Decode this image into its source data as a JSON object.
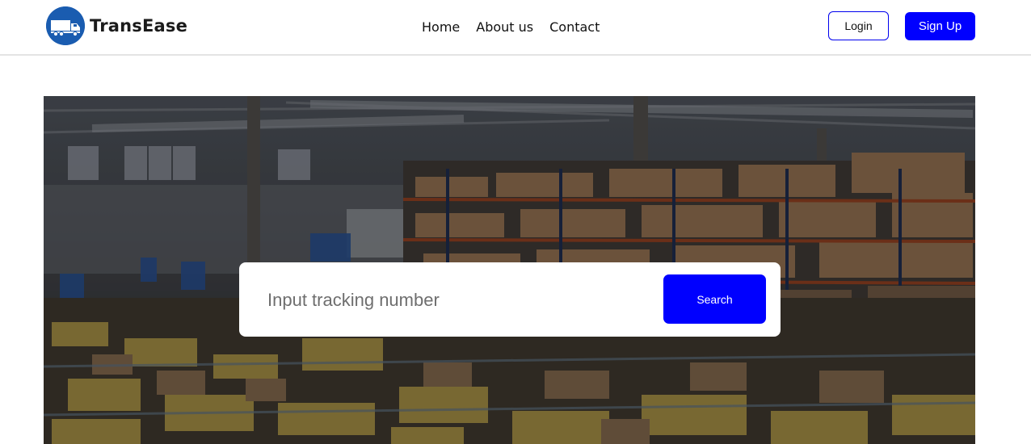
{
  "brand": {
    "name": "TransEase",
    "logo_icon": "truck-icon",
    "logo_color": "#1a5cb0"
  },
  "nav": {
    "links": [
      "Home",
      "About us",
      "Contact"
    ]
  },
  "auth": {
    "login_label": "Login",
    "signup_label": "Sign Up",
    "accent": "#0000ff"
  },
  "hero": {
    "image": "warehouse-photo",
    "search": {
      "placeholder": "Input tracking number",
      "value": "",
      "button_label": "Search"
    }
  }
}
